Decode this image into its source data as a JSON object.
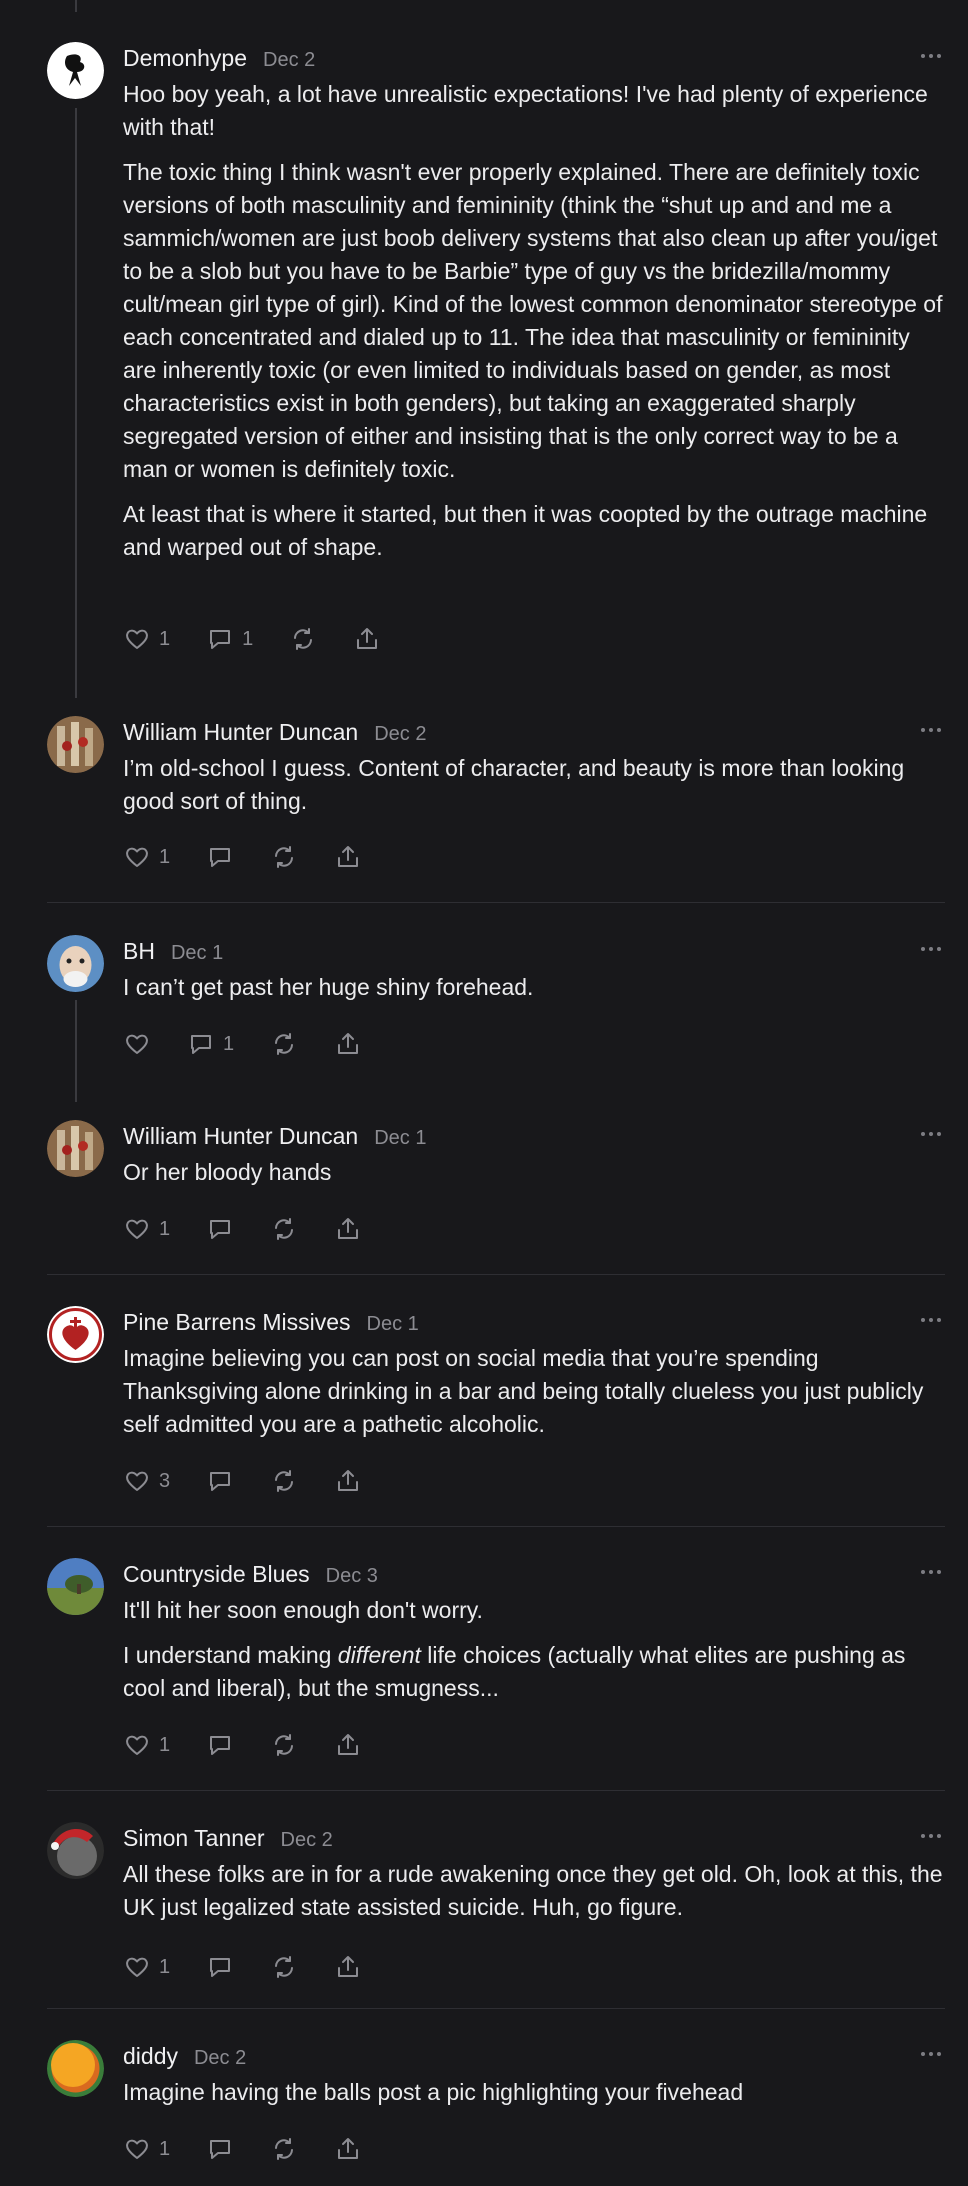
{
  "comments": [
    {
      "author": "Demonhype",
      "date": "Dec 2",
      "paragraphs": [
        "Hoo boy yeah, a lot have unrealistic expectations! I've had plenty of experience with that!",
        "The toxic thing I think wasn't ever properly explained. There are definitely toxic versions of both masculinity and femininity (think the “shut up and and me a sammich/women are just boob delivery systems that also clean up after you/iget to be a slob but you have to be Barbie” type of guy vs the bridezilla/mommy cult/mean girl type of girl). Kind of the lowest common denominator stereotype of each concentrated and dialed up to 11. The idea that masculinity or femininity are inherently toxic (or even limited to individuals based on gender, as most characteristics exist in both genders), but taking an exaggerated sharply segregated version of either and insisting that is the only correct way to be a man or women is definitely toxic.",
        "At least that is where it started, but then it was coopted by the outrage machine and warped out of shape."
      ],
      "likes": "1",
      "replies": "1"
    },
    {
      "author": "William Hunter Duncan",
      "date": "Dec 2",
      "paragraphs": [
        "I’m old-school I guess. Content of character, and beauty is more than looking good sort of thing."
      ],
      "likes": "1",
      "replies": ""
    },
    {
      "author": "BH",
      "date": "Dec 1",
      "paragraphs": [
        "I can’t get past her huge shiny forehead."
      ],
      "likes": "",
      "replies": "1"
    },
    {
      "author": "William Hunter Duncan",
      "date": "Dec 1",
      "paragraphs": [
        "Or her bloody hands"
      ],
      "likes": "1",
      "replies": ""
    },
    {
      "author": "Pine Barrens Missives",
      "date": "Dec 1",
      "paragraphs": [
        "Imagine believing you can post on social media that you’re spending Thanksgiving alone drinking in a bar and being totally clueless you just publicly self admitted you are a pathetic alcoholic."
      ],
      "likes": "3",
      "replies": ""
    },
    {
      "author": "Countryside Blues",
      "date": "Dec 3",
      "paragraphs": [
        "It'll hit her soon enough don't worry.",
        "I understand making different life choices (actually what elites are pushing as cool and liberal), but the smugness..."
      ],
      "likes": "1",
      "replies": ""
    },
    {
      "author": "Simon Tanner",
      "date": "Dec 2",
      "paragraphs": [
        "All these folks are in for a rude awakening once they get old. Oh, look at this, the UK just legalized state assisted suicide. Huh, go figure."
      ],
      "likes": "1",
      "replies": ""
    },
    {
      "author": "diddy",
      "date": "Dec 2",
      "paragraphs": [
        "Imagine having the balls post a pic highlighting your fivehead"
      ],
      "likes": "1",
      "replies": ""
    }
  ],
  "icons": {
    "like": "heart-icon",
    "reply": "comment-bubble-icon",
    "restack": "restack-icon",
    "share": "share-icon",
    "more": "ellipsis-icon"
  }
}
